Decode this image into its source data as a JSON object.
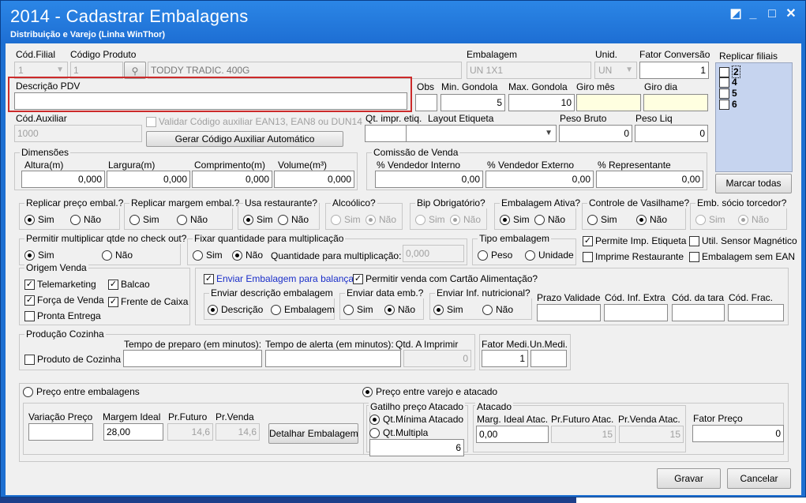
{
  "window": {
    "title": "2014 - Cadastrar Embalagens",
    "subtitle": "Distribuição e Varejo (Linha WinThor)"
  },
  "row1": {
    "cod_filial": {
      "label": "Cód.Filial",
      "value": "1"
    },
    "cod_produto": {
      "label": "Código Produto",
      "value": "1",
      "desc": "TODDY TRADIC. 400G"
    },
    "embalagem": {
      "label": "Embalagem",
      "value": "UN 1X1"
    },
    "unid": {
      "label": "Unid.",
      "value": "UN"
    },
    "fator_conversao": {
      "label": "Fator Conversão",
      "value": "1"
    }
  },
  "replicar_filiais": {
    "label": "Replicar filiais",
    "items": [
      "2",
      "4",
      "5",
      "6"
    ],
    "button": "Marcar todas"
  },
  "row2": {
    "descricao_pdv": {
      "label": "Descrição PDV",
      "value": ""
    },
    "obs": {
      "label": "Obs",
      "value": ""
    },
    "min_gondola": {
      "label": "Min. Gondola",
      "value": "5"
    },
    "max_gondola": {
      "label": "Max. Gondola",
      "value": "10"
    },
    "giro_mes": {
      "label": "Giro mês",
      "value": ""
    },
    "giro_dia": {
      "label": "Giro dia",
      "value": ""
    }
  },
  "row3": {
    "cod_auxiliar": {
      "label": "Cód.Auxiliar",
      "value": "1000"
    },
    "validar_label": "Validar Código auxiliar EAN13, EAN8 ou DUN14",
    "gerar_btn": "Gerar Código Auxiliar Automático",
    "qt_impr": {
      "label": "Qt. impr. etiq.",
      "value": ""
    },
    "layout_etiqueta": {
      "label": "Layout Etiqueta",
      "value": ""
    },
    "peso_bruto": {
      "label": "Peso Bruto",
      "value": "0"
    },
    "peso_liq": {
      "label": "Peso Liq",
      "value": "0"
    }
  },
  "dimensoes": {
    "title": "Dimensões",
    "altura": {
      "label": "Altura(m)",
      "value": "0,000"
    },
    "largura": {
      "label": "Largura(m)",
      "value": "0,000"
    },
    "comprimento": {
      "label": "Comprimento(m)",
      "value": "0,000"
    },
    "volume": {
      "label": "Volume(m³)",
      "value": "0,000"
    }
  },
  "comissao": {
    "title": "Comissão de Venda",
    "interno": {
      "label": "% Vendedor Interno",
      "value": "0,00"
    },
    "externo": {
      "label": "% Vendedor Externo",
      "value": "0,00"
    },
    "representante": {
      "label": "% Representante",
      "value": "0,00"
    }
  },
  "radios": {
    "sim": "Sim",
    "nao": "Não",
    "replicar_preco": "Replicar preço embal.?",
    "replicar_margem": "Replicar margem embal.?",
    "usa_restaurante": "Usa restaurante?",
    "alcoolico": "Alcoólico?",
    "bip": "Bip Obrigatório?",
    "ativa": "Embalagem Ativa?",
    "vasilhame": "Controle de Vasilhame?",
    "socio": "Emb. sócio torcedor?"
  },
  "multiplicar": {
    "label": "Permitir multiplicar qtde no check out?",
    "fixar_label": "Fixar quantidade para multiplicação",
    "qtd_label": "Quantidade para multiplicação:",
    "qtd_value": "0,000"
  },
  "tipo_embalagem": {
    "label": "Tipo embalagem",
    "peso": "Peso",
    "unidade": "Unidade"
  },
  "checks_right": {
    "permite_imp": "Permite Imp. Etiqueta",
    "util_sensor": "Util. Sensor Magnético",
    "imprime_rest": "Imprime Restaurante",
    "sem_ean": "Embalagem sem EAN"
  },
  "origem": {
    "title": "Origem Venda",
    "telemarketing": "Telemarketing",
    "balcao": "Balcao",
    "forca": "Força de Venda",
    "frente": "Frente de Caixa",
    "pronta": "Pronta Entrega"
  },
  "balanca": {
    "enviar": "Enviar Embalagem para balança",
    "cartao": "Permitir venda com Cartão Alimentação?",
    "desc_label": "Enviar descrição embalagem",
    "descricao": "Descrição",
    "embalagem": "Embalagem",
    "data_label": "Enviar data emb.?",
    "inf_label": "Enviar Inf. nutricional?",
    "prazo": "Prazo Validade",
    "cod_inf": "Cód. Inf. Extra",
    "cod_tara": "Cód. da tara",
    "cod_frac": "Cód. Frac."
  },
  "producao": {
    "title": "Produção Cozinha",
    "produto": "Produto de Cozinha",
    "tempo_preparo": "Tempo de preparo (em minutos):",
    "tempo_alerta": "Tempo de alerta (em minutos):",
    "qtd_imprimir": {
      "label": "Qtd. A Imprimir",
      "value": "0"
    },
    "fator_medi": {
      "label": "Fator Medi.",
      "value": "1"
    },
    "un_medi": {
      "label": "Un.Medi.",
      "value": ""
    }
  },
  "preco": {
    "entre_emb": "Preço entre embalagens",
    "variacao": "Variação Preço",
    "margem": {
      "label": "Margem Ideal",
      "value": "28,00"
    },
    "pr_futuro": {
      "label": "Pr.Futuro",
      "value": "14,6"
    },
    "pr_venda": {
      "label": "Pr.Venda",
      "value": "14,6"
    },
    "detalhar": "Detalhar Embalagem",
    "varejo_atacado": "Preço entre varejo e atacado",
    "gatilho": "Gatilho preço Atacado",
    "qt_minima": "Qt.Mínima Atacado",
    "qt_multipla": "Qt.Multipla",
    "gatilho_value": "6",
    "atacado": "Atacado",
    "marg_atac": {
      "label": "Marg. Ideal Atac.",
      "value": "0,00"
    },
    "fut_atac": {
      "label": "Pr.Futuro Atac.",
      "value": "15"
    },
    "venda_atac": {
      "label": "Pr.Venda Atac.",
      "value": "15"
    },
    "fator_preco": {
      "label": "Fator Preço",
      "value": "0"
    }
  },
  "footer": {
    "gravar": "Gravar",
    "cancelar": "Cancelar"
  },
  "colors": {
    "titlebar": "#1e6fd4",
    "highlight": "#cc2a2a",
    "list": "#c6d4ef",
    "link": "#1a2ec9"
  }
}
